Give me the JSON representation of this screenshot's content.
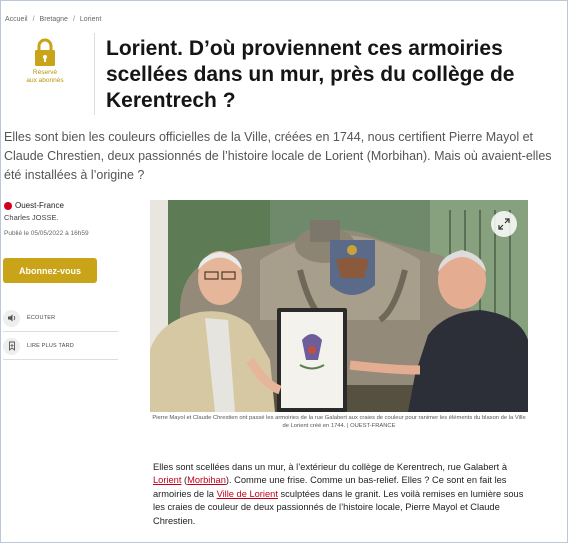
{
  "breadcrumb": [
    "Accueil",
    "Bretagne",
    "Lorient"
  ],
  "lock": {
    "label_line1": "Réservé",
    "label_line2": "aux abonnés"
  },
  "article": {
    "title": "Lorient. D’où proviennent ces armoiries scellées dans un mur, près du collège de Kerentrech ?",
    "lead": "Elles sont bien les couleurs officielles de la Ville, créées en 1744, nous certifient Pierre Mayol et Claude Chrestien, deux passionnés de l’histoire locale de Lorient (Morbihan). Mais où avaient-elles été installées à l’origine ?",
    "source": "Ouest-France",
    "author": "Charles JOSSE.",
    "published": "Publié le 05/05/2022 à 16h59",
    "subscribe_label": "Abonnez-vous",
    "listen_label": "ÉCOUTER",
    "later_label": "LIRE PLUS TARD",
    "caption": "Pierre Mayol et Claude Chrestien ont passé les armoiries de la rue Galabert aux craies de couleur pour ranimer les éléments du blason de la Ville de Lorient créé en 1744. | OUEST-FRANCE",
    "body": {
      "t1": "Elles sont scellées dans un mur, à l’extérieur du collège de Kerentrech, rue Galabert à ",
      "link1": "Lorient",
      "t2": " (",
      "link2": "Morbihan",
      "t3": "). Comme une frise. Comme un bas-relief. Elles ? Ce sont en fait les armoiries de la ",
      "link3": "Ville de Lorient",
      "t4": " sculptées dans le granit. Les voilà remises en lumière sous les craies de couleur de deux passionnés de l’histoire locale, Pierre Mayol et Claude Chrestien."
    }
  },
  "colors": {
    "accent_gold": "#c9a318",
    "link_red": "#c2001b",
    "source_red": "#d0021b"
  }
}
